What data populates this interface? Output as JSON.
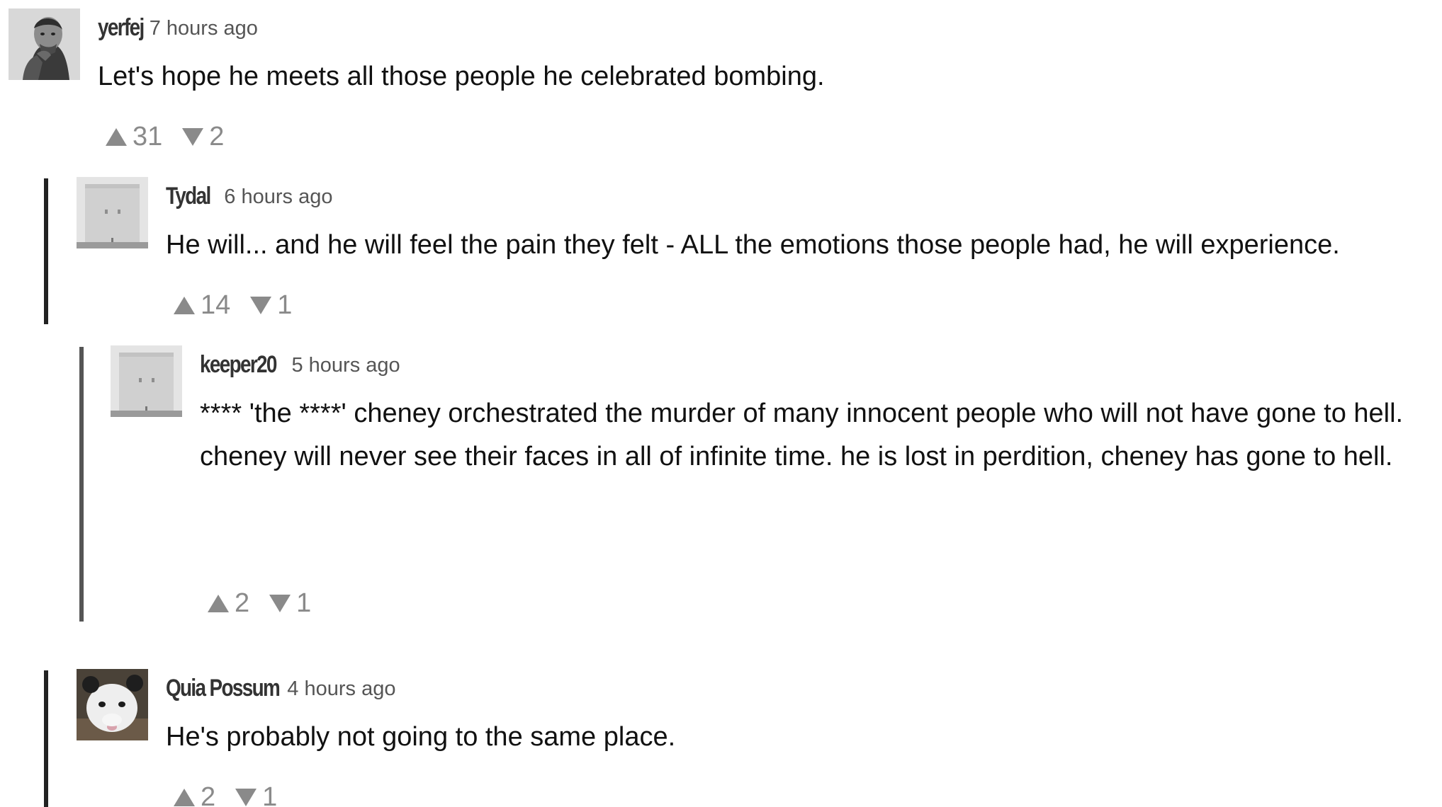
{
  "comments": [
    {
      "username": "yerfej",
      "time": "7 hours ago",
      "lines": [
        "Let's hope he meets all those people he celebrated bombing."
      ],
      "upvotes": "31",
      "downvotes": "2",
      "avatar_icon": "man-portrait-photo"
    },
    {
      "username": "Tydal",
      "time": "6 hours ago",
      "lines": [
        "He will... and he will feel the pain they felt - ALL the emotions those people had, he will experience."
      ],
      "upvotes": "14",
      "downvotes": "1",
      "avatar_icon": "paper-bag-face-avatar"
    },
    {
      "username": "keeper20",
      "time": "5 hours ago",
      "lines": [
        "**** 'the ****' cheney orchestrated the murder of many innocent  people who will not have gone to hell.",
        "cheney will never see their faces in all of infinite time. he is lost in perdition, cheney has gone to hell."
      ],
      "upvotes": "2",
      "downvotes": "1",
      "avatar_icon": "paper-bag-face-avatar"
    },
    {
      "username": "Quia Possum",
      "time": "4 hours ago",
      "lines": [
        "He's probably not going to the same place."
      ],
      "upvotes": "2",
      "downvotes": "1",
      "avatar_icon": "opossum-photo"
    }
  ],
  "colors": {
    "thread_bar": "#222222",
    "vote_gray": "#8a8a8a",
    "username": "#333333"
  }
}
